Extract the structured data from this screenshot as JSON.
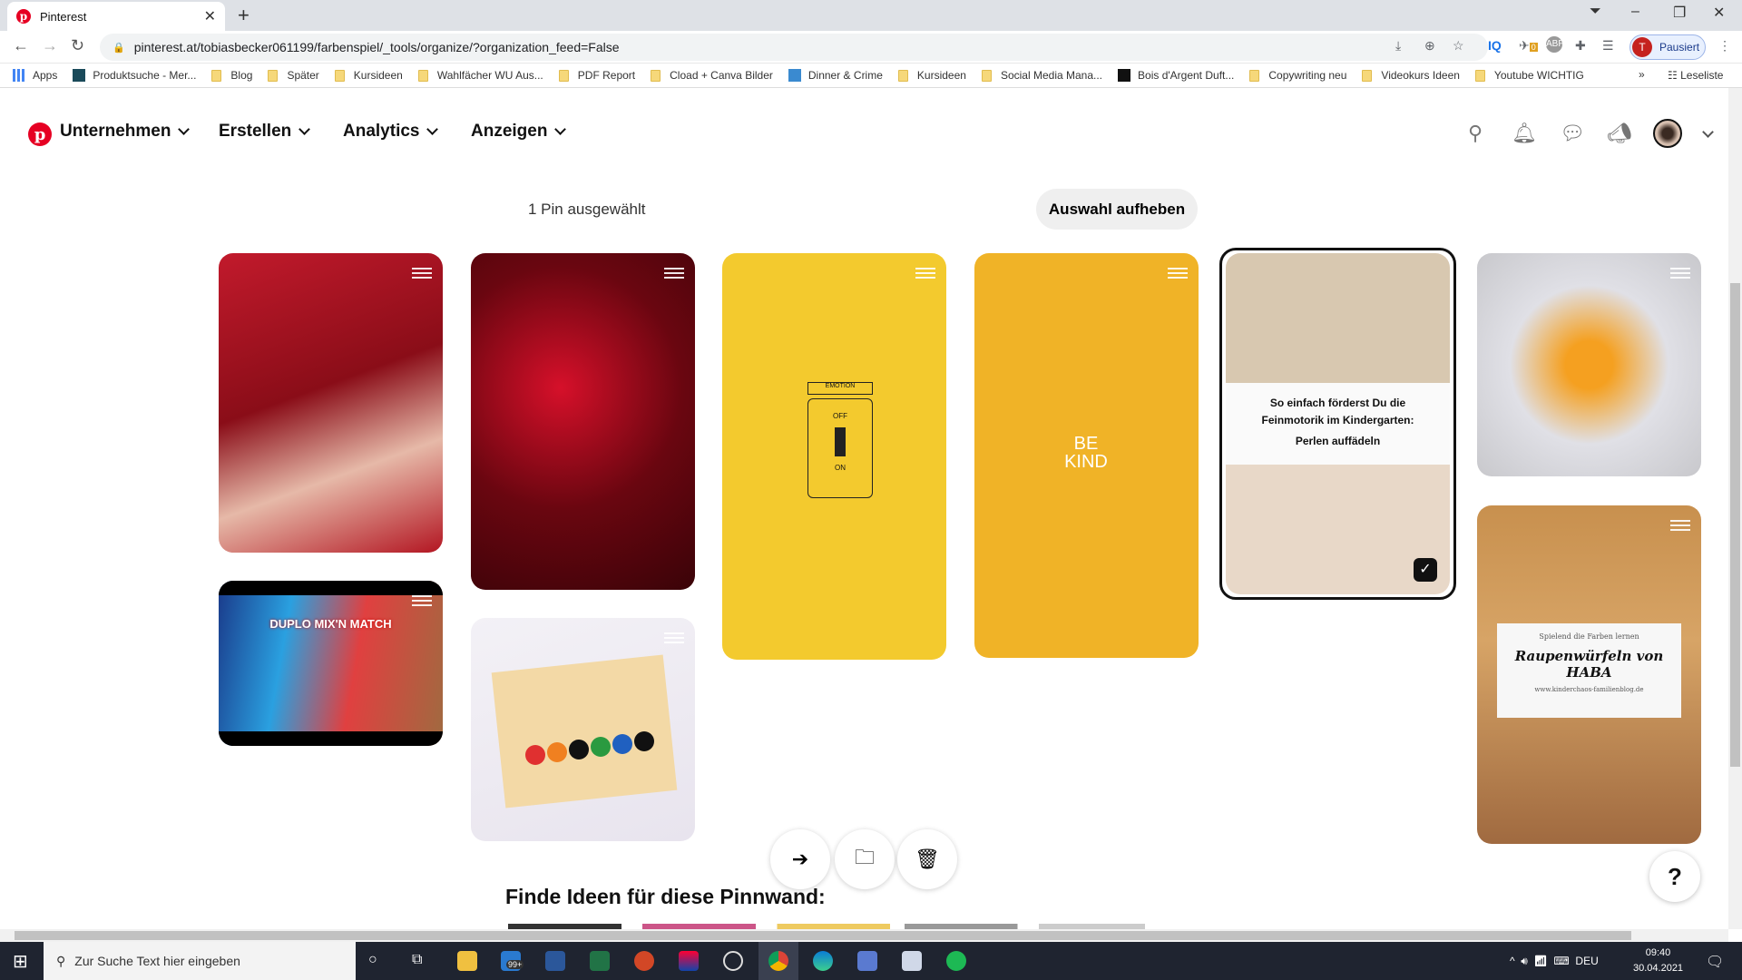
{
  "browser": {
    "tab_title": "Pinterest",
    "url": "pinterest.at/tobiasbecker061199/farbenspiel/_tools/organize/?organization_feed=False",
    "profile_initial": "T",
    "profile_status": "Pausiert",
    "bookmarks": [
      {
        "label": "Apps",
        "icon": "apps-grid"
      },
      {
        "label": "Produktsuche - Mer...",
        "icon": "site"
      },
      {
        "label": "Blog",
        "icon": "folder"
      },
      {
        "label": "Später",
        "icon": "folder"
      },
      {
        "label": "Kursideen",
        "icon": "folder"
      },
      {
        "label": "Wahlfächer WU Aus...",
        "icon": "folder"
      },
      {
        "label": "PDF Report",
        "icon": "folder"
      },
      {
        "label": "Cload + Canva Bilder",
        "icon": "folder"
      },
      {
        "label": "Dinner & Crime",
        "icon": "site"
      },
      {
        "label": "Kursideen",
        "icon": "folder"
      },
      {
        "label": "Social Media Mana...",
        "icon": "folder"
      },
      {
        "label": "Bois d'Argent Duft...",
        "icon": "site"
      },
      {
        "label": "Copywriting neu",
        "icon": "folder"
      },
      {
        "label": "Videokurs Ideen",
        "icon": "folder"
      },
      {
        "label": "Youtube WICHTIG",
        "icon": "folder"
      }
    ],
    "reading_list": "Leseliste",
    "ext_badge": "0"
  },
  "header": {
    "nav": [
      "Unternehmen",
      "Erstellen",
      "Analytics",
      "Anzeigen"
    ],
    "brand_color": "#e60023"
  },
  "toolbar": {
    "selected_count": "1 Pin ausgewählt",
    "clear_label": "Auswahl aufheben"
  },
  "pins": [
    {
      "bg": "linear-gradient(160deg,#c21a2c,#8a0d18 45%,#e6b9a8 70%,#b31622)",
      "selected": false
    },
    {
      "bg": "linear-gradient(100deg,#1a3a8a,#2aa0e0 30%,#e04040 60%,#a06a40)",
      "top_bar": "#000",
      "text": "DUPLO MIX'N MATCH",
      "selected": false
    },
    {
      "bg": "radial-gradient(circle at 40% 40%,#d6102a,#6a0610 50%,#3a0308)",
      "selected": false
    },
    {
      "bg": "linear-gradient(160deg,#f3f1f6,#e8e4ee)",
      "caterpillar": true,
      "selected": false
    },
    {
      "bg": "#f3ca2e",
      "text": "EMOTION",
      "sub": [
        "OFF",
        "ON"
      ],
      "selected": false
    },
    {
      "bg": "#f0b327",
      "text": "BE KIND",
      "selected": false
    },
    {
      "bg": "linear-gradient(180deg,#d8c8b0 0 38%,#fafafa 38% 62%,#e8d8c8 62%)",
      "text": [
        "So einfach förderst Du die",
        "Feinmotorik im Kindergarten:",
        "Perlen auffädeln"
      ],
      "selected": true
    },
    {
      "bg": "radial-gradient(circle at 50% 50%,#f5a020 0 15%,#e0e0e6 50%,#c8c8cc)",
      "selected": false
    },
    {
      "bg": "linear-gradient(180deg,#c8904e,#d7a466 40%,#a06a40)",
      "text": [
        "Spielend die Farben lernen",
        "Raupenwürfeln von HABA",
        "www.kinderchaos-familienblog.de"
      ],
      "selected": false
    }
  ],
  "actions": [
    {
      "icon": "move-icon"
    },
    {
      "icon": "copy-to-board-icon"
    },
    {
      "icon": "trash-icon"
    }
  ],
  "suggest_title": "Finde Ideen für diese Pinnwand:",
  "help": "?",
  "taskbar": {
    "search_placeholder": "Zur Suche Text hier eingeben",
    "badge": "99+",
    "lang": "DEU",
    "time": "09:40",
    "date": "30.04.2021"
  }
}
